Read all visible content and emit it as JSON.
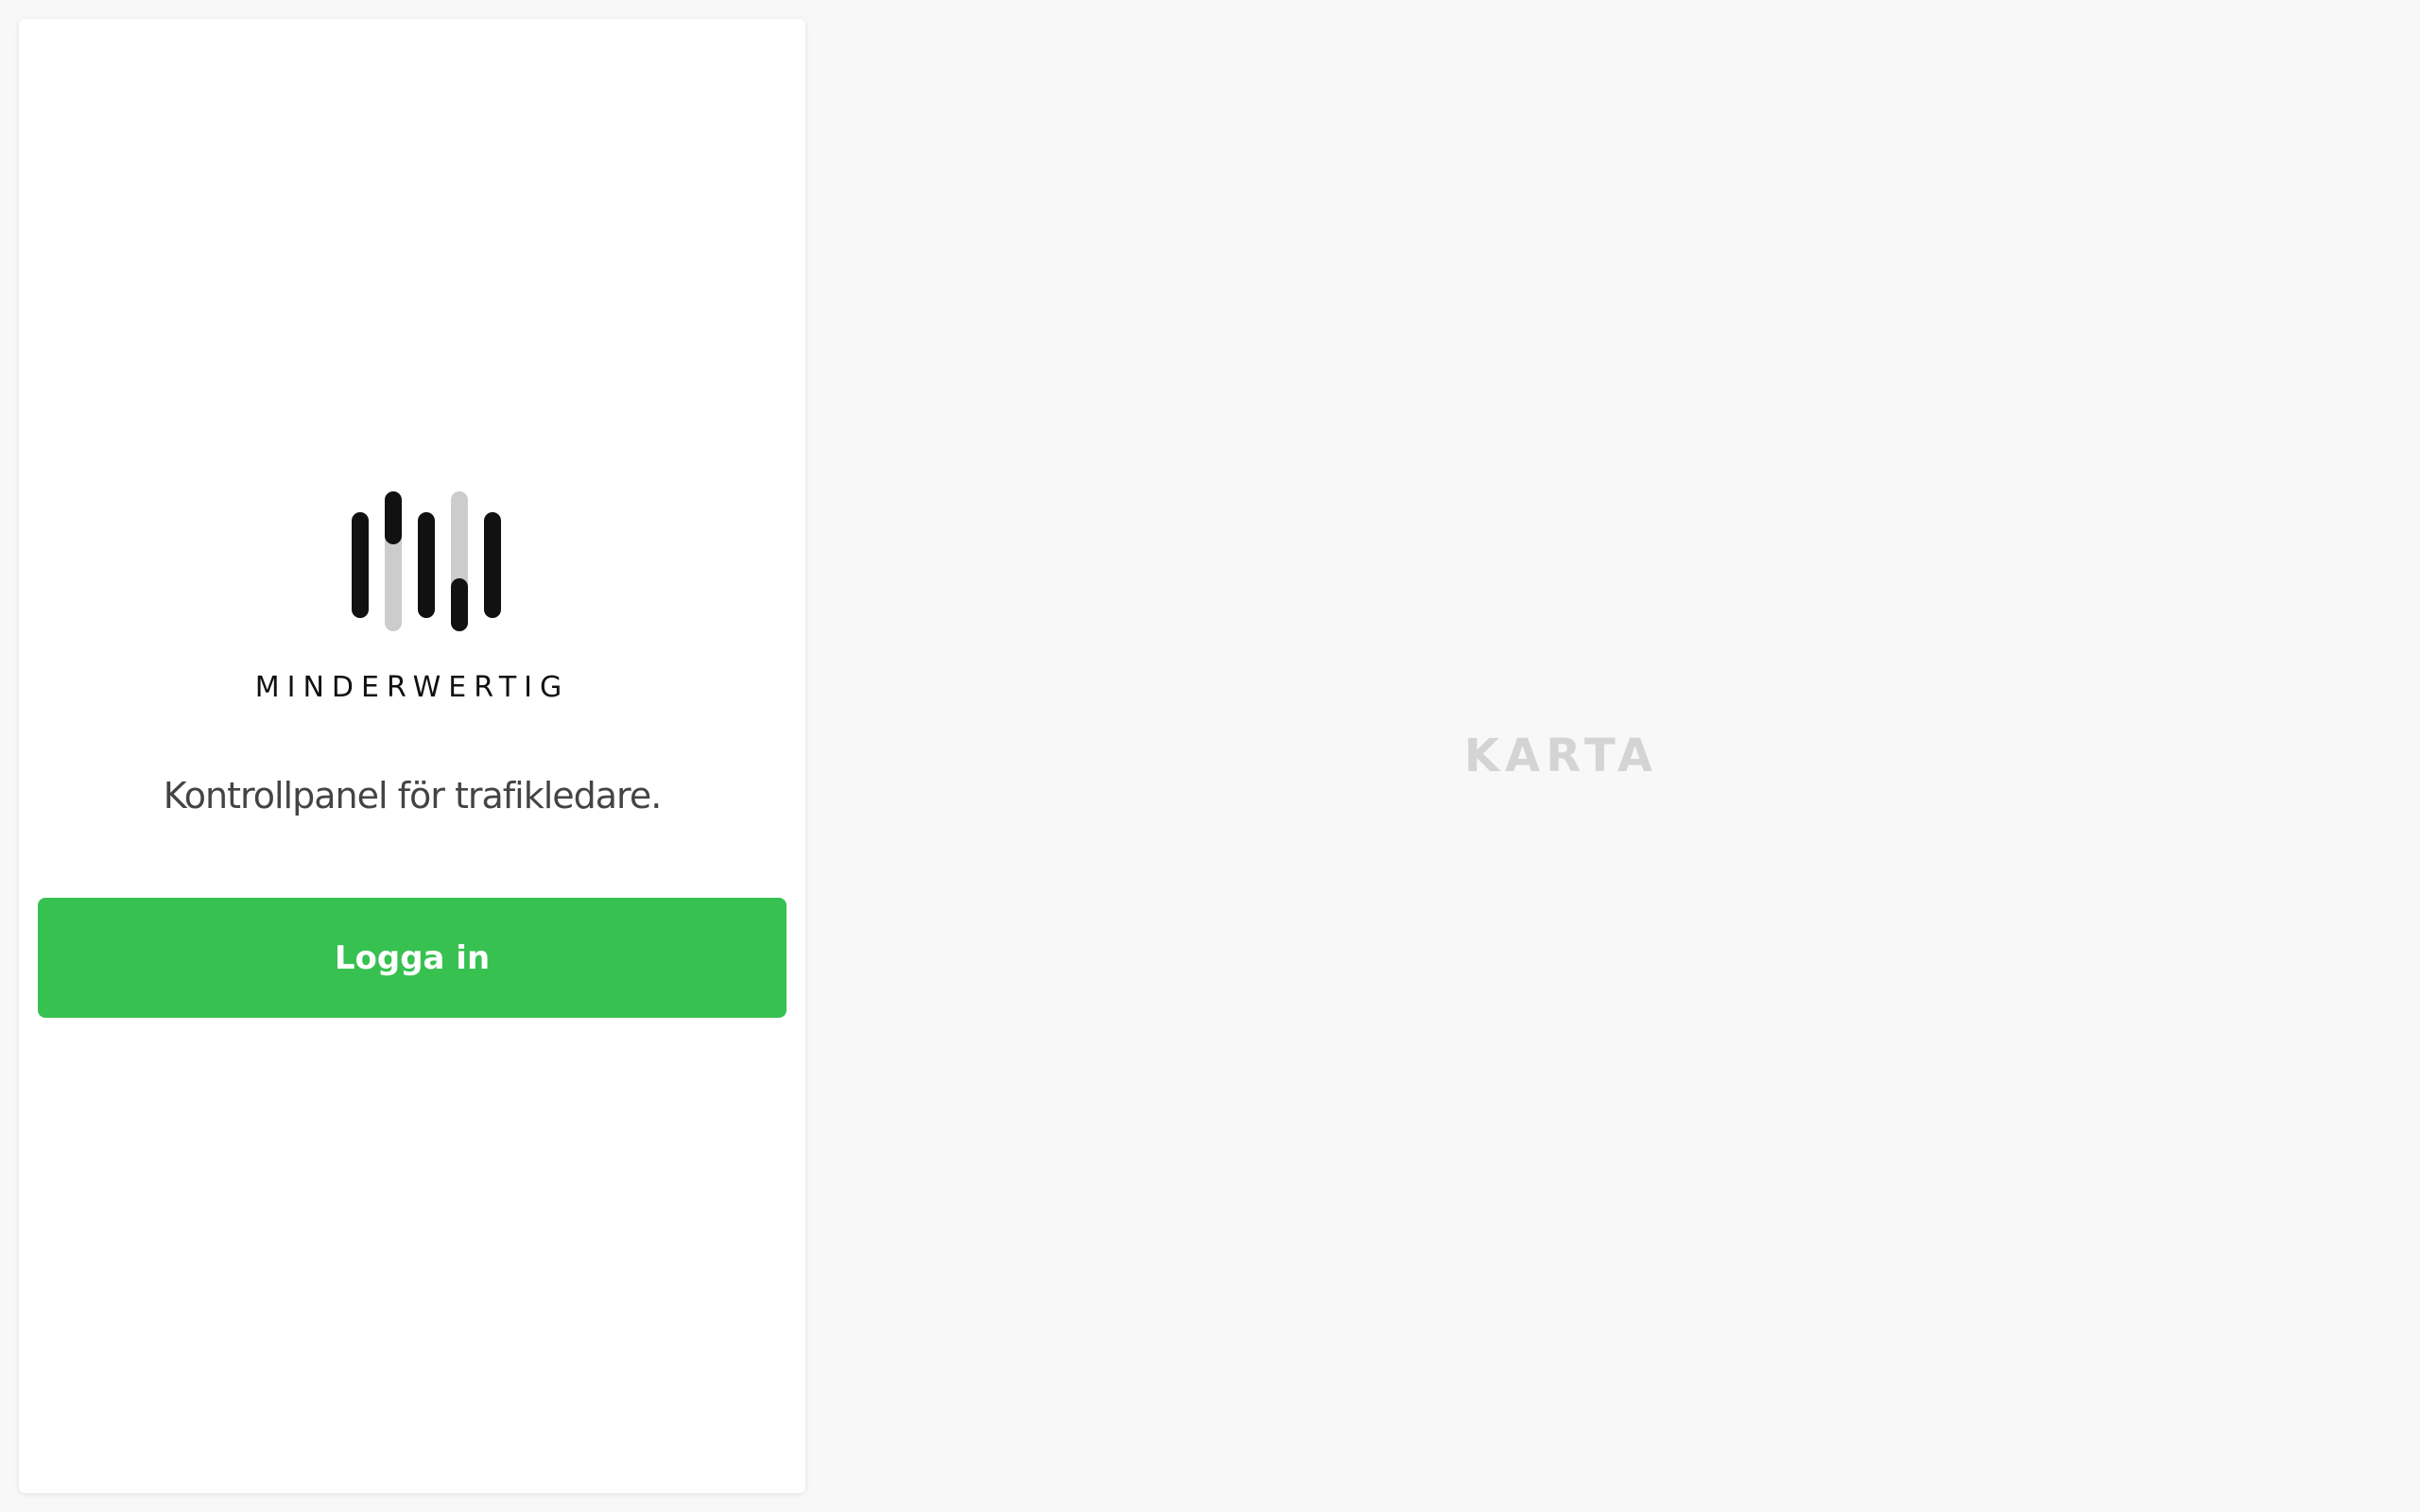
{
  "brand": {
    "name": "MINDERWERTIG",
    "logo_icon": "equalizer-bars-logo-icon",
    "tagline": "Kontrollpanel för trafikledare."
  },
  "login": {
    "label": "Logga in",
    "color": "#37c151"
  },
  "map": {
    "placeholder": "KARTA"
  },
  "colors": {
    "background": "#f8f8f8",
    "panel": "#ffffff",
    "logo_dark": "#111111",
    "logo_light": "#cccccc"
  }
}
